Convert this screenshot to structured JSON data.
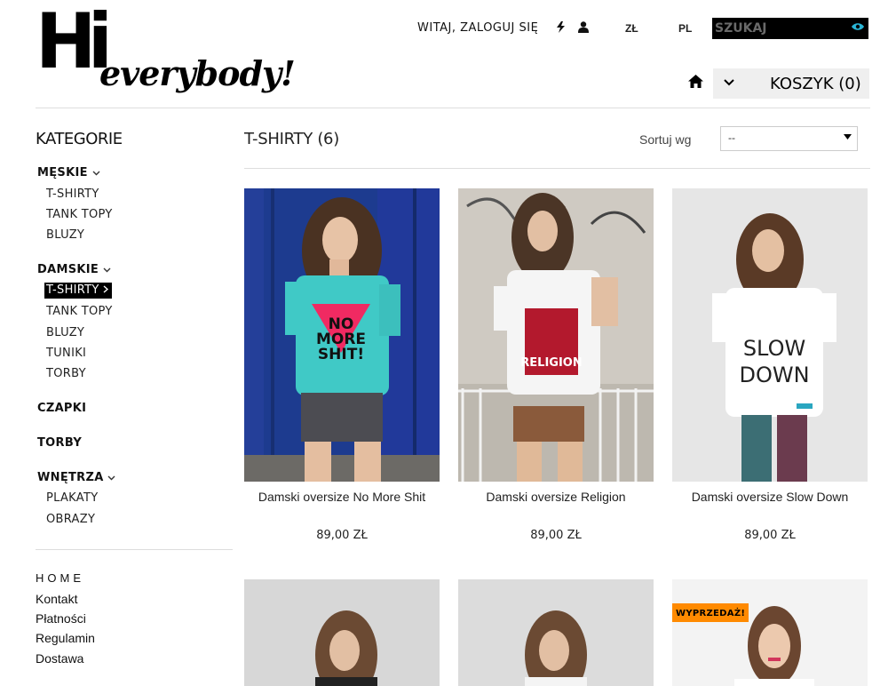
{
  "logo": {
    "hi": "Hi",
    "everybody": "everybody!"
  },
  "top": {
    "welcome": "WITAJ, ZALOGUJ SIĘ",
    "bolt_icon": "bolt-icon",
    "user_icon": "user-icon",
    "currency": "ZŁ",
    "language": "PL",
    "search_placeholder": "SZUKAJ",
    "search_icon": "eye-icon",
    "home_icon": "home-icon",
    "cart_label": "KOSZYK (0)"
  },
  "sidebar": {
    "title": "KATEGORIE",
    "categories": [
      {
        "label": "MĘSKIE",
        "has_toggle": true,
        "items": [
          "T-SHIRTY",
          "TANK TOPY",
          "BLUZY"
        ]
      },
      {
        "label": "DAMSKIE",
        "has_toggle": true,
        "items": [
          "T-SHIRTY",
          "TANK TOPY",
          "BLUZY",
          "TUNIKI",
          "TORBY"
        ],
        "active_item": "T-SHIRTY"
      },
      {
        "label": "CZAPKI",
        "has_toggle": false,
        "items": []
      },
      {
        "label": "TORBY",
        "has_toggle": false,
        "items": []
      },
      {
        "label": "WNĘTRZA",
        "has_toggle": true,
        "items": [
          "PLAKATY",
          "OBRAZY"
        ]
      }
    ],
    "footer_links": [
      "HOME",
      "Kontakt",
      "Płatności",
      "Regulamin",
      "Dostawa"
    ]
  },
  "main": {
    "title": "T-SHIRTY (6)",
    "sort_label": "Sortuj wg",
    "sort_value": "--",
    "products": [
      {
        "name": "Damski oversize No More Shit",
        "price": "89,00 ZŁ",
        "shirt_print": "NO MORE SHIT!"
      },
      {
        "name": "Damski oversize Religion",
        "price": "89,00 ZŁ",
        "shirt_print": "RELIGION"
      },
      {
        "name": "Damski oversize Slow Down",
        "price": "89,00 ZŁ",
        "shirt_print": "SLOW DOWN"
      },
      {
        "name": "",
        "price": ""
      },
      {
        "name": "",
        "price": ""
      },
      {
        "name": "",
        "price": "",
        "badge": "WYPRZEDAŻ!"
      }
    ]
  },
  "colors": {
    "accent_search": "#2ab5d6",
    "sale_badge": "#ff8a00",
    "active_bg": "#000000"
  }
}
